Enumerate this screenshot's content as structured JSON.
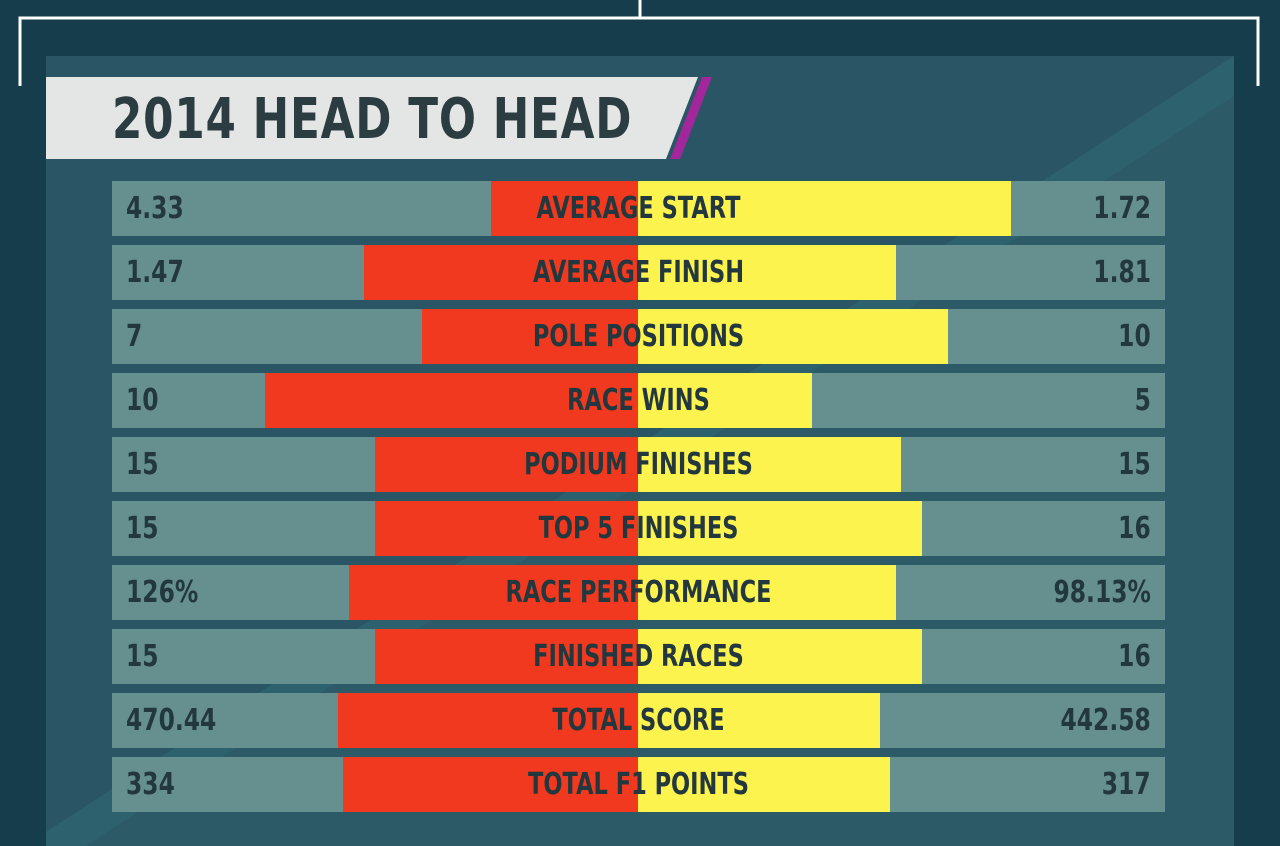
{
  "title": "2014 HEAD TO HEAD",
  "colors": {
    "background": "#163d4b",
    "panel": "#2a5564",
    "row": "#66908f",
    "left_bar": "#f0391f",
    "right_bar": "#fdf34e",
    "banner": "#e4e6e6",
    "accent": "#a2279a",
    "text": "#23383e"
  },
  "chart_data": {
    "type": "bar",
    "layout": "diverging-horizontal",
    "title": "2014 HEAD TO HEAD",
    "categories": [
      "AVERAGE START",
      "AVERAGE FINISH",
      "POLE POSITIONS",
      "RACE WINS",
      "PODIUM FINISHES",
      "TOP 5 FINISHES",
      "RACE PERFORMANCE",
      "FINISHED RACES",
      "TOTAL SCORE",
      "TOTAL F1 POINTS"
    ],
    "left_labels": [
      "4.33",
      "1.47",
      "7",
      "10",
      "15",
      "15",
      "126%",
      "15",
      "470.44",
      "334"
    ],
    "right_labels": [
      "1.72",
      "1.81",
      "10",
      "5",
      "15",
      "16",
      "98.13%",
      "16",
      "442.58",
      "317"
    ],
    "left_bar_share": [
      0.28,
      0.52,
      0.41,
      0.71,
      0.5,
      0.5,
      0.55,
      0.5,
      0.57,
      0.56
    ],
    "right_bar_share": [
      0.71,
      0.49,
      0.59,
      0.33,
      0.5,
      0.54,
      0.49,
      0.54,
      0.46,
      0.48
    ]
  }
}
